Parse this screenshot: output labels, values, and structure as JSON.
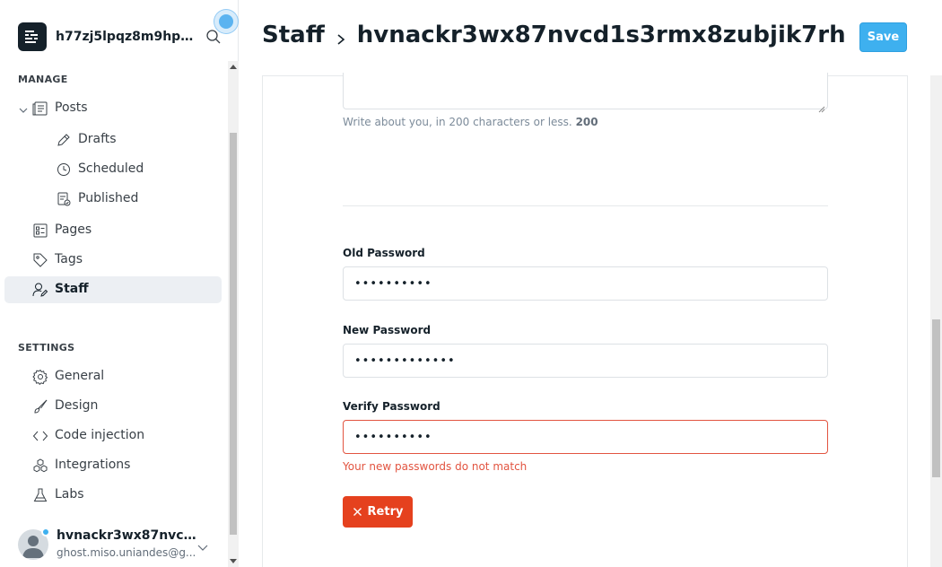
{
  "app": {
    "site_name": "h77zj5lpqz8m9hpy..."
  },
  "sidebar": {
    "manage_label": "MANAGE",
    "settings_label": "SETTINGS",
    "items": [
      {
        "label": "Posts",
        "icon": "posts-icon"
      },
      {
        "label": "Drafts",
        "icon": "pencil-icon"
      },
      {
        "label": "Scheduled",
        "icon": "clock-icon"
      },
      {
        "label": "Published",
        "icon": "published-icon"
      },
      {
        "label": "Pages",
        "icon": "pages-icon"
      },
      {
        "label": "Tags",
        "icon": "tag-icon"
      },
      {
        "label": "Staff",
        "icon": "staff-icon",
        "active": true
      },
      {
        "label": "General",
        "icon": "gear-icon"
      },
      {
        "label": "Design",
        "icon": "brush-icon"
      },
      {
        "label": "Code injection",
        "icon": "code-icon"
      },
      {
        "label": "Integrations",
        "icon": "integrations-icon"
      },
      {
        "label": "Labs",
        "icon": "flask-icon"
      }
    ]
  },
  "user": {
    "name": "hvnackr3wx87nvcd1s...",
    "email": "ghost.miso.uniandes@g..."
  },
  "header": {
    "breadcrumb_root": "Staff",
    "breadcrumb_current": "hvnackr3wx87nvcd1s3rmx8zubjik7rh",
    "save_label": "Save"
  },
  "form": {
    "bio_hint": "Write about you, in 200 characters or less.",
    "bio_count": "200",
    "old_password_label": "Old Password",
    "old_password_value": "••••••••••",
    "new_password_label": "New Password",
    "new_password_value": "•••••••••••••",
    "verify_password_label": "Verify Password",
    "verify_password_value": "••••••••••",
    "error_message": "Your new passwords do not match",
    "retry_label": "Retry"
  },
  "colors": {
    "accent": "#3eb0ef",
    "error": "#e25440",
    "retry": "#e5411e"
  }
}
